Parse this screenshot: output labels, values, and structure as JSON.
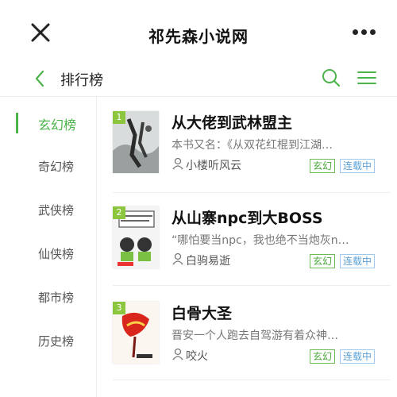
{
  "header": {
    "site_title": "祁先森小说网",
    "close_icon": "close-icon",
    "more_icon": "more-icon"
  },
  "subheader": {
    "page_title": "排行榜",
    "back_icon": "chevron-left-icon",
    "search_icon": "search-icon",
    "menu_icon": "menu-icon"
  },
  "colors": {
    "accent": "#4cb34a",
    "genre_tag": "#4aa83a",
    "status_tag": "#5aa0d6",
    "rank_badge": "#8cc63f"
  },
  "sidebar": {
    "items": [
      {
        "label": "玄幻榜",
        "active": true
      },
      {
        "label": "奇幻榜",
        "active": false
      },
      {
        "label": "武侠榜",
        "active": false
      },
      {
        "label": "仙侠榜",
        "active": false
      },
      {
        "label": "都市榜",
        "active": false
      },
      {
        "label": "历史榜",
        "active": false
      }
    ]
  },
  "books": [
    {
      "rank": "1",
      "title": "从大佬到武林盟主",
      "desc": "本书又名：《从双花红棍到江湖…",
      "author": "小楼听风云",
      "genre": "玄幻",
      "status": "连载中"
    },
    {
      "rank": "2",
      "title": "从山寨npc到大BOSS",
      "desc": "“哪怕要当npc，我也绝不当炮灰n…",
      "author": "白驹易逝",
      "genre": "玄幻",
      "status": "连载中"
    },
    {
      "rank": "3",
      "title": "白骨大圣",
      "desc": "晋安一个人跑去自驾游有着众神…",
      "author": "咬火",
      "genre": "玄幻",
      "status": "连载中"
    }
  ]
}
